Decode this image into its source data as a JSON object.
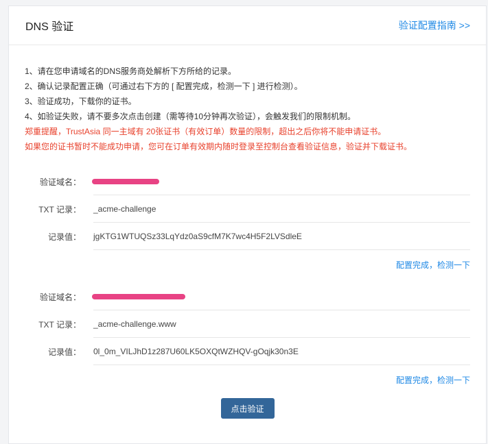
{
  "header": {
    "title": "DNS 验证",
    "guide_link": "验证配置指南 >>"
  },
  "instructions": [
    {
      "text": "1、请在您申请域名的DNS服务商处解析下方所给的记录。",
      "color": "#333333"
    },
    {
      "text": "2、确认记录配置正确（可通过右下方的 [ 配置完成，检测一下 ] 进行检测）。",
      "color": "#333333"
    },
    {
      "text": "3、验证成功，下载你的证书。",
      "color": "#333333"
    },
    {
      "text": "4、如验证失败，请不要多次点击创建（需等待10分钟再次验证），会触发我们的限制机制。",
      "color": "#333333"
    },
    {
      "text": "郑重提醒，TrustAsia 同一主域有 20张证书（有效订单）数量的限制，超出之后你将不能申请证书。",
      "color": "#e8412c"
    },
    {
      "text": "如果您的证书暂时不能成功申请，您可在订单有效期内随时登录至控制台查看验证信息，验证并下载证书。",
      "color": "#e8412c"
    }
  ],
  "records": [
    {
      "domain_label": "验证域名：",
      "domain_value": "",
      "domain_redacted": true,
      "txt_label": "TXT 记录：",
      "txt_value": "_acme-challenge",
      "value_label": "记录值：",
      "record_value": "jgKTG1WTUQSz33LqYdz0aS9cfM7K7wc4H5F2LVSdleE",
      "check_link": "配置完成，检测一下"
    },
    {
      "domain_label": "验证域名：",
      "domain_value": "",
      "domain_redacted": true,
      "txt_label": "TXT 记录：",
      "txt_value": "_acme-challenge.www",
      "value_label": "记录值：",
      "record_value": "0l_0m_VILJhD1z287U60LK5OXQtWZHQV-gOqjk30n3E",
      "check_link": "配置完成，检测一下"
    }
  ],
  "submit_button": "点击验证",
  "colors": {
    "link": "#1e88e5",
    "warning": "#e8412c",
    "button": "#336699",
    "redaction": "#e6337a"
  }
}
